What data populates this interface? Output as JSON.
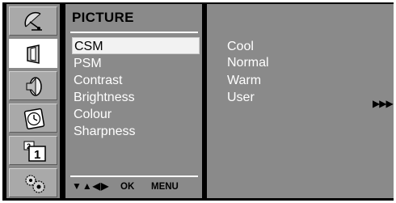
{
  "menu": {
    "title": "PICTURE",
    "items": [
      {
        "label": "CSM"
      },
      {
        "label": "PSM"
      },
      {
        "label": "Contrast"
      },
      {
        "label": "Brightness"
      },
      {
        "label": "Colour"
      },
      {
        "label": "Sharpness"
      }
    ],
    "selected_item": "CSM",
    "footer": {
      "nav_glyphs": "▼▲◀▶",
      "ok_label": "OK",
      "menu_label": "MENU"
    }
  },
  "icons": [
    {
      "name": "satellite-dish-icon"
    },
    {
      "name": "picture-icon",
      "active": true
    },
    {
      "name": "speaker-icon"
    },
    {
      "name": "clock-icon"
    },
    {
      "name": "channel-number-icon",
      "text_small": "2",
      "text_large": "1"
    },
    {
      "name": "gears-icon"
    }
  ],
  "submenu": {
    "items": [
      {
        "label": "Cool"
      },
      {
        "label": "Normal"
      },
      {
        "label": "Warm"
      },
      {
        "label": "User"
      }
    ],
    "arrow": "▶▶▶"
  },
  "colors": {
    "background": "#000000",
    "panel": "#8a8a8a",
    "icon_cell": "#a9a9a9",
    "highlight": "#f2f2f2",
    "text": "#ffffff"
  }
}
